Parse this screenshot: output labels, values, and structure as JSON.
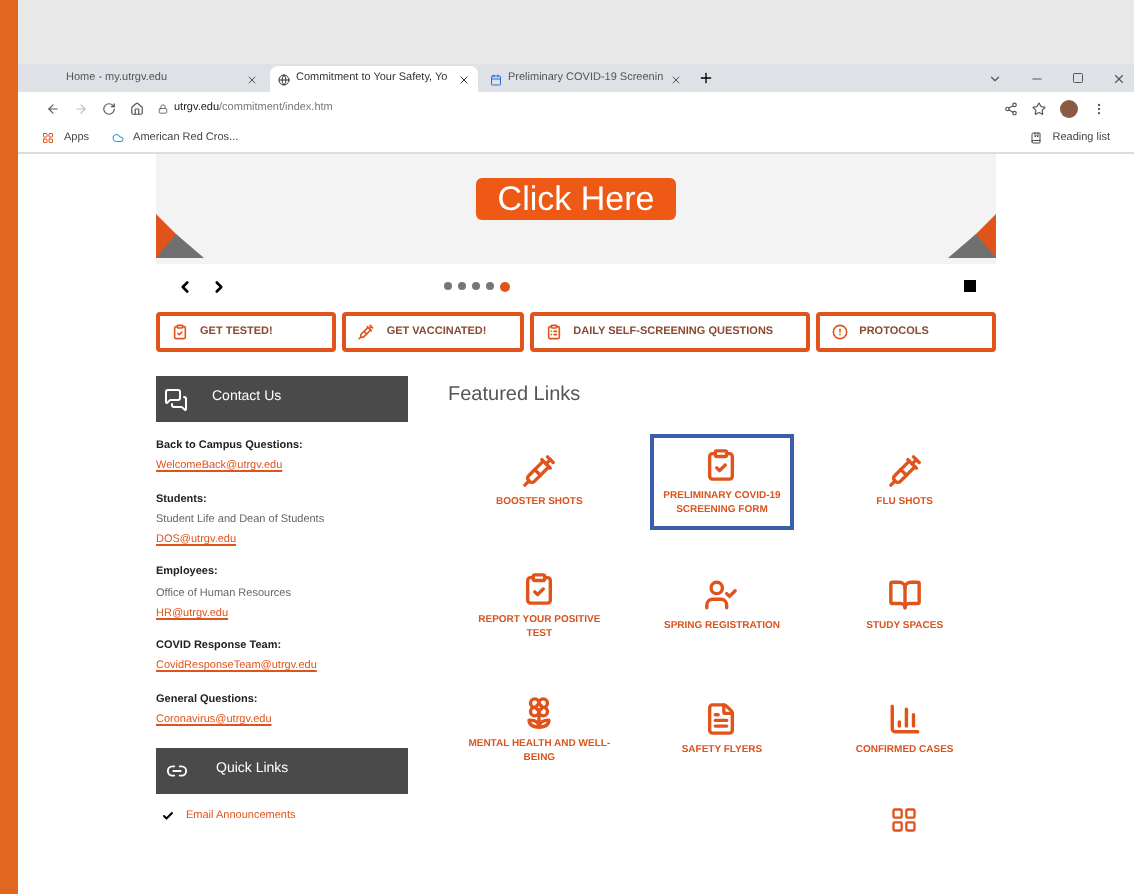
{
  "browser": {
    "tabs": [
      {
        "title": "Home - my.utrgv.edu",
        "selected": false
      },
      {
        "title": "Commitment to Your Safety, Yo",
        "selected": true
      },
      {
        "title": "Preliminary COVID-19 Screenin",
        "selected": false
      }
    ],
    "url_host": "utrgv.edu",
    "url_path": "/commitment/index.htm",
    "bookmarks": [
      "Apps",
      "American Red Cros..."
    ],
    "reading_list": "Reading list"
  },
  "hero": {
    "button": "Click Here"
  },
  "carousel": {
    "dots": [
      {
        "selected": false
      },
      {
        "selected": false
      },
      {
        "selected": false
      },
      {
        "selected": false
      },
      {
        "selected": true
      }
    ]
  },
  "quick_buttons": [
    {
      "label": "GET TESTED!",
      "kind": "clipboard"
    },
    {
      "label": "GET VACCINATED!",
      "kind": "syringe"
    },
    {
      "label": "DAILY SELF-SCREENING QUESTIONS",
      "kind": "check"
    },
    {
      "label": "PROTOCOLS",
      "kind": "alert"
    }
  ],
  "contact": {
    "title": "Contact Us",
    "groups": [
      {
        "heading": "Back to Campus Questions:",
        "email": "WelcomeBack@utrgv.edu"
      },
      {
        "heading": "Students:",
        "lines": [
          "Student Life and Dean of Students"
        ],
        "email": "DOS@utrgv.edu"
      },
      {
        "heading": "Employees:",
        "lines": [
          "Office of Human Resources"
        ],
        "email": "HR@utrgv.edu"
      },
      {
        "heading": "COVID Response Team:",
        "email": "CovidResponseTeam@utrgv.edu"
      },
      {
        "heading": "General Questions:",
        "email": "Coronavirus@utrgv.edu"
      }
    ]
  },
  "quick_links": {
    "title": "Quick Links",
    "items": [
      "Email Announcements"
    ]
  },
  "featured": {
    "title": "Featured Links",
    "items": [
      {
        "label": "BOOSTER SHOTS",
        "kind": "syringe",
        "selected": false
      },
      {
        "label": "PRELIMINARY COVID-19 SCREENING FORM",
        "kind": "clipboard",
        "selected": true
      },
      {
        "label": "FLU SHOTS",
        "kind": "syringe",
        "selected": false
      },
      {
        "label": "REPORT YOUR POSITIVE TEST",
        "kind": "clipboard",
        "selected": false
      },
      {
        "label": "SPRING REGISTRATION",
        "kind": "user",
        "selected": false
      },
      {
        "label": "STUDY SPACES",
        "kind": "book",
        "selected": false
      },
      {
        "label": "MENTAL HEALTH AND WELL-BEING",
        "kind": "lotus",
        "selected": false
      },
      {
        "label": "SAFETY FLYERS",
        "kind": "file",
        "selected": false
      },
      {
        "label": "CONFIRMED CASES",
        "kind": "chart",
        "selected": false
      }
    ]
  }
}
